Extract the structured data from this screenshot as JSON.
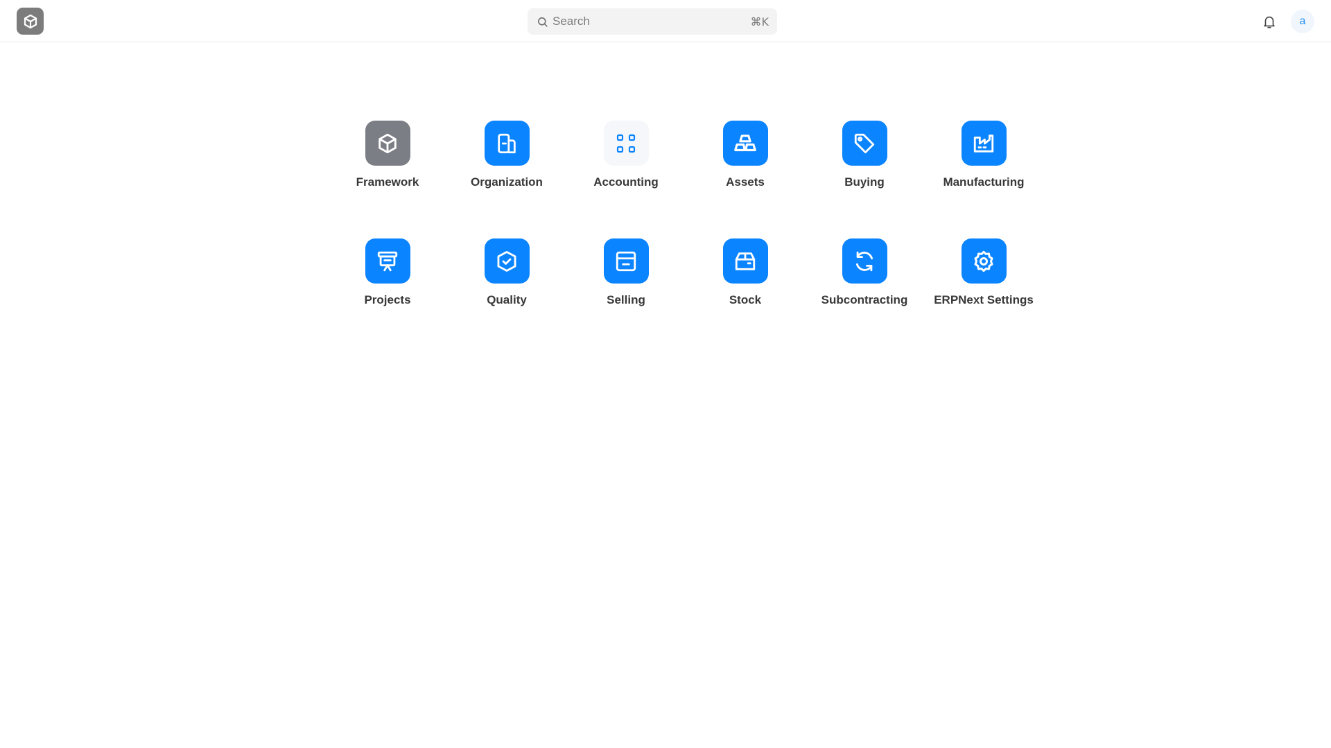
{
  "header": {
    "search": {
      "placeholder": "Search",
      "shortcut": "⌘K"
    },
    "avatar_initial": "a"
  },
  "colors": {
    "accent": "#0b84ff",
    "framework_gray": "#7b7e84",
    "accounting_bg": "#f5f7fa"
  },
  "apps": [
    {
      "label": "Framework",
      "icon": "cube-icon"
    },
    {
      "label": "Organization",
      "icon": "building-icon"
    },
    {
      "label": "Accounting",
      "icon": "grid-dots-icon"
    },
    {
      "label": "Assets",
      "icon": "blocks-icon"
    },
    {
      "label": "Buying",
      "icon": "tag-icon"
    },
    {
      "label": "Manufacturing",
      "icon": "factory-icon"
    },
    {
      "label": "Projects",
      "icon": "presentation-icon"
    },
    {
      "label": "Quality",
      "icon": "shield-check-icon"
    },
    {
      "label": "Selling",
      "icon": "store-icon"
    },
    {
      "label": "Stock",
      "icon": "box-icon"
    },
    {
      "label": "Subcontracting",
      "icon": "refresh-icon"
    },
    {
      "label": "ERPNext Settings",
      "icon": "gear-icon"
    }
  ]
}
